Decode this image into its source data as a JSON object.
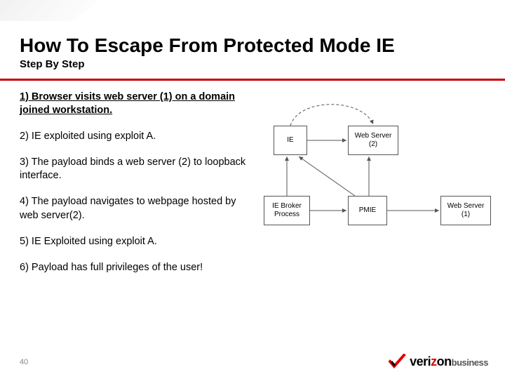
{
  "title": "How To Escape From Protected Mode IE",
  "subtitle": "Step By Step",
  "steps": [
    "1) Browser visits web server (1) on a domain joined workstation.",
    "2) IE exploited using exploit A.",
    "3) The payload binds a web server (2) to loopback interface.",
    "4) The payload navigates to webpage hosted by web server(2).",
    "5) IE Exploited using exploit A.",
    "6) Payload has full privileges of the user!"
  ],
  "current_step_index": 0,
  "diagram": {
    "boxes": {
      "ie": "IE",
      "webserver2": "Web Server\n(2)",
      "iebroker": "IE Broker\nProcess",
      "pmie": "PMIE",
      "webserver1": "Web Server\n(1)"
    }
  },
  "page_number": "40",
  "logo": {
    "brand1": "veri",
    "brand2": "z",
    "brand3": "on",
    "suffix": "business"
  }
}
